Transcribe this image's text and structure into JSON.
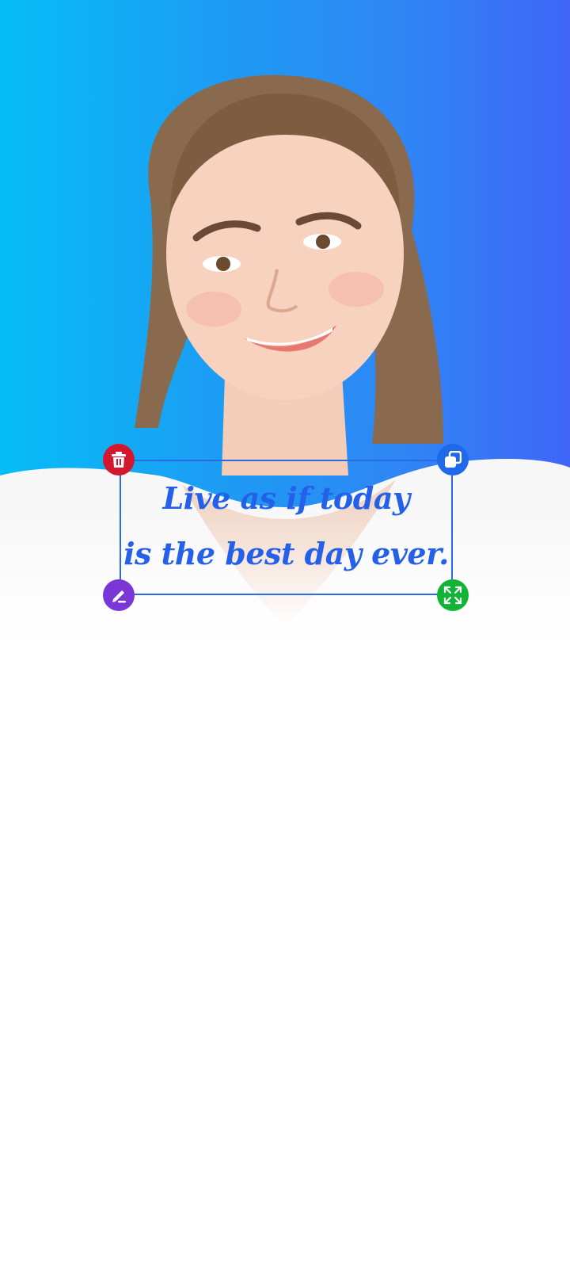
{
  "editor": {
    "canvas_background": "#ffffff",
    "photo": {
      "subject": "smiling young woman portrait",
      "background_gradient": [
        "#06bdf7",
        "#3f66f7"
      ]
    },
    "text_sticker": {
      "lines": [
        "Live as if today",
        "is the best day ever."
      ],
      "color": "#2460e8",
      "frame_color": "#2a6ae6"
    },
    "handles": [
      {
        "name": "delete",
        "icon": "trash-icon",
        "color": "#d3172f"
      },
      {
        "name": "duplicate",
        "icon": "copy-icon",
        "color": "#1f6ae8"
      },
      {
        "name": "edit",
        "icon": "pencil-icon",
        "color": "#7b36d6"
      },
      {
        "name": "resize",
        "icon": "expand-icon",
        "color": "#12b336"
      }
    ]
  }
}
